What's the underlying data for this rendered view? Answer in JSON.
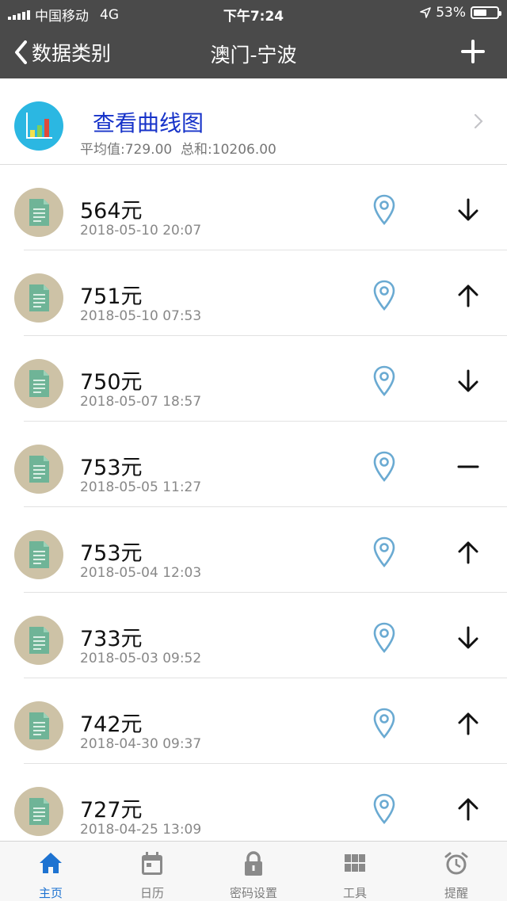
{
  "status_bar": {
    "carrier": "中国移动",
    "network": "4G",
    "time": "下午7:24",
    "battery": "53%"
  },
  "nav": {
    "back_label": "数据类别",
    "title": "澳门-宁波",
    "add_icon": "plus-icon"
  },
  "chart_link": {
    "title": "查看曲线图",
    "average": "平均值:729.00",
    "total": "总和:10206.00"
  },
  "records": [
    {
      "amount": "564元",
      "time": "2018-05-10 20:07",
      "trend": "down"
    },
    {
      "amount": "751元",
      "time": "2018-05-10 07:53",
      "trend": "up"
    },
    {
      "amount": "750元",
      "time": "2018-05-07 18:57",
      "trend": "down"
    },
    {
      "amount": "753元",
      "time": "2018-05-05 11:27",
      "trend": "flat"
    },
    {
      "amount": "753元",
      "time": "2018-05-04 12:03",
      "trend": "up"
    },
    {
      "amount": "733元",
      "time": "2018-05-03 09:52",
      "trend": "down"
    },
    {
      "amount": "742元",
      "time": "2018-04-30 09:37",
      "trend": "up"
    },
    {
      "amount": "727元",
      "time": "2018-04-25 13:09",
      "trend": "up"
    }
  ],
  "tabs": [
    {
      "label": "主页",
      "icon": "home-icon",
      "active": true
    },
    {
      "label": "日历",
      "icon": "calendar-icon",
      "active": false
    },
    {
      "label": "密码设置",
      "icon": "lock-icon",
      "active": false
    },
    {
      "label": "工具",
      "icon": "grid-icon",
      "active": false
    },
    {
      "label": "提醒",
      "icon": "alarm-clock-icon",
      "active": false
    }
  ],
  "colors": {
    "nav_bg": "#4a4a4a",
    "accent": "#1e73d1",
    "link": "#1733c9",
    "pin": "#6aaad2",
    "doc_bg": "#cdc2a6",
    "doc_fg": "#6fb497"
  }
}
